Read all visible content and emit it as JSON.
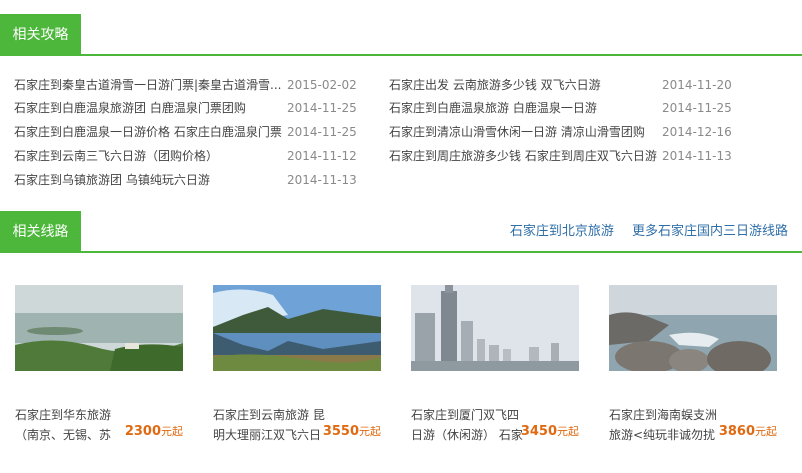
{
  "section_guides": {
    "title": "相关攻略",
    "articles": [
      {
        "title": "石家庄到秦皇古道滑雪一日游门票|秦皇古道滑雪...",
        "date": "2015-02-02"
      },
      {
        "title": "石家庄出发 云南旅游多少钱 双飞六日游",
        "date": "2014-11-20"
      },
      {
        "title": "石家庄到白鹿温泉旅游团 白鹿温泉门票团购",
        "date": "2014-11-25"
      },
      {
        "title": "石家庄到白鹿温泉旅游 白鹿温泉一日游",
        "date": "2014-11-25"
      },
      {
        "title": "石家庄到白鹿温泉一日游价格 石家庄白鹿温泉门票",
        "date": "2014-11-25"
      },
      {
        "title": "石家庄到清凉山滑雪休闲一日游 清凉山滑雪团购",
        "date": "2014-12-16"
      },
      {
        "title": "石家庄到云南三飞六日游（团购价格）",
        "date": "2014-11-12"
      },
      {
        "title": "石家庄到周庄旅游多少钱 石家庄到周庄双飞六日游",
        "date": "2014-11-13"
      },
      {
        "title": "石家庄到乌镇旅游团 乌镇纯玩六日游",
        "date": "2014-11-13"
      }
    ]
  },
  "section_routes": {
    "title": "相关线路",
    "links": [
      "石家庄到北京旅游",
      "更多石家庄国内三日游线路"
    ],
    "cards": [
      {
        "title": "石家庄到华东旅游（南京、无锡、苏州、杭...",
        "price": "2300",
        "unit": "元起"
      },
      {
        "title": "石家庄到云南旅游 昆明大理丽江双飞六日4+5...",
        "price": "3550",
        "unit": "元起"
      },
      {
        "title": "石家庄到厦门双飞四日游（休闲游） 石家庄到...",
        "price": "3450",
        "unit": "元起"
      },
      {
        "title": "石家庄到海南蜈支洲旅游<纯玩非诚勿扰六日游>",
        "price": "3860",
        "unit": "元起"
      }
    ]
  }
}
